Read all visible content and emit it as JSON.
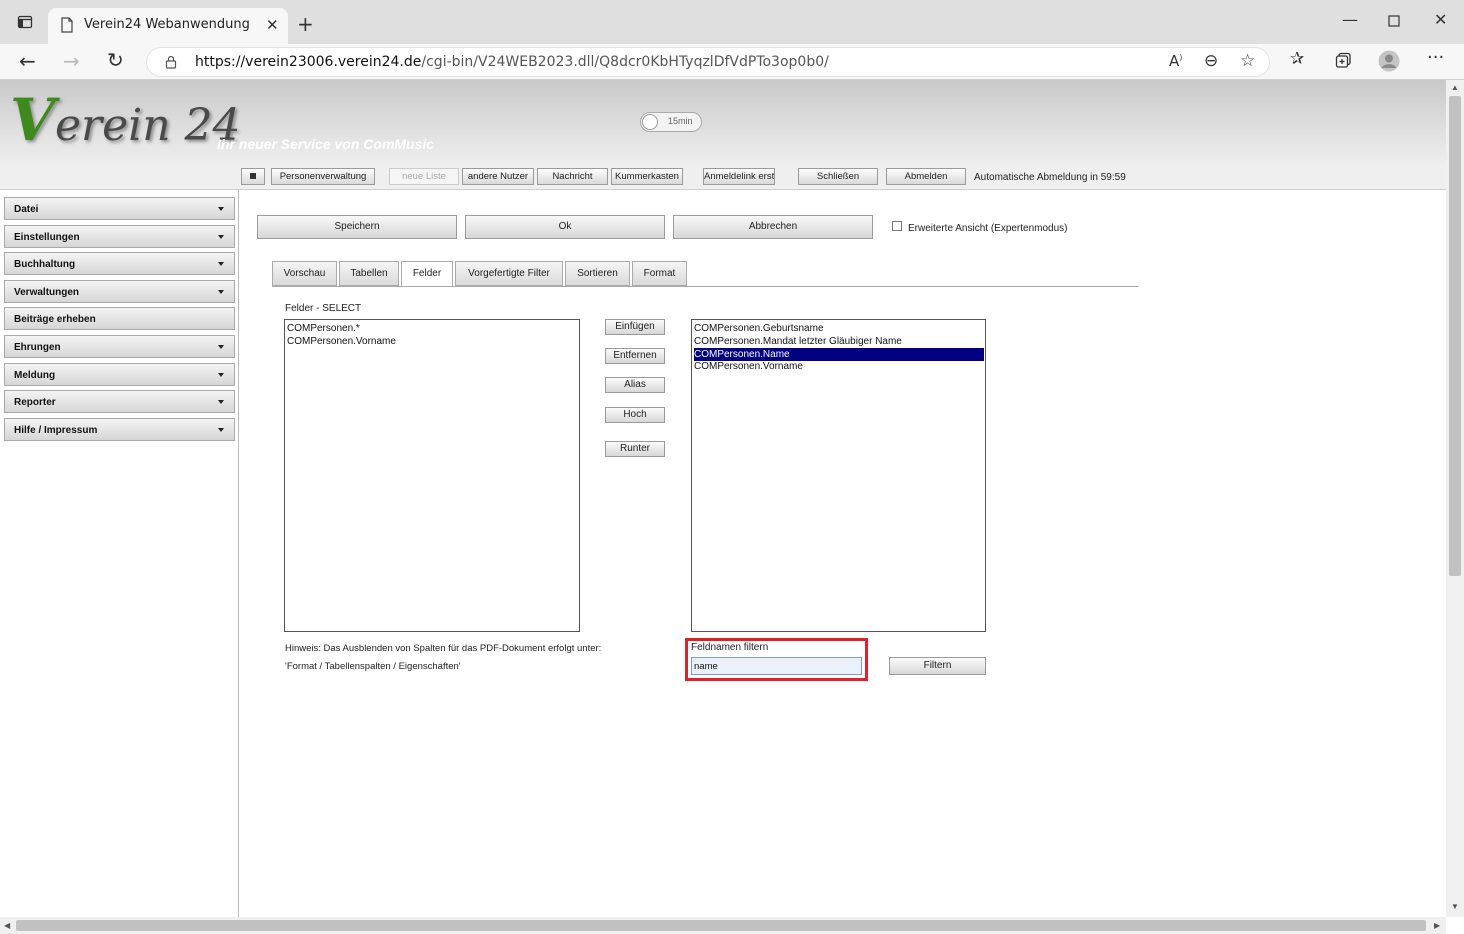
{
  "browser": {
    "tab_title": "Verein24 Webanwendung",
    "url_host": "https://verein23006.verein24.de",
    "url_path": "/cgi-bin/V24WEB2023.dll/Q8dcr0KbHTyqzlDfVdPTo3op0b0/",
    "icons": [
      "sidebar-toggle-icon",
      "page-icon",
      "close-icon",
      "plus-icon",
      "minimize-icon",
      "maximize-icon",
      "window-close-icon",
      "back-icon",
      "forward-icon",
      "reload-icon",
      "lock-icon",
      "read-aloud-icon",
      "zoom-out-icon",
      "add-favorite-icon",
      "favorites-icon",
      "collections-icon",
      "profile-icon",
      "more-icon"
    ]
  },
  "header": {
    "logo_v": "V",
    "logo_rest": "erein 24",
    "tagline": "Ihr neuer Service von ComMusic",
    "timer": "15min"
  },
  "toolbar": {
    "buttons": [
      "Personenverwaltung",
      "neue Liste",
      "andere Nutzer",
      "Nachricht",
      "Kummerkasten",
      "Anmeldelink erst",
      "Schließen",
      "Abmelden"
    ],
    "auto_logout": "Automatische Abmeldung in 59:59"
  },
  "sidebar": {
    "items": [
      "Datei",
      "Einstellungen",
      "Buchhaltung",
      "Verwaltungen",
      "Beiträge erheben",
      "Ehrungen",
      "Meldung",
      "Reporter",
      "Hilfe / Impressum"
    ]
  },
  "actions": {
    "save": "Speichern",
    "ok": "Ok",
    "cancel": "Abbrechen",
    "expert_mode": "Erweiterte Ansicht (Expertenmodus)"
  },
  "tabs": [
    "Vorschau",
    "Tabellen",
    "Felder",
    "Vorgefertigte Filter",
    "Sortieren",
    "Format"
  ],
  "active_tab": "Felder",
  "felder": {
    "label": "Felder - SELECT",
    "selected_fields": [
      "COMPersonen.*",
      "COMPersonen.Vorname"
    ],
    "buttons": [
      "Einfügen",
      "Entfernen",
      "Alias",
      "Hoch",
      "Runter"
    ],
    "available_fields": [
      "COMPersonen.Geburtsname",
      "COMPersonen.Mandat letzter Gläubiger Name",
      "COMPersonen.Name",
      "COMPersonen.Vorname"
    ],
    "selected_available": "COMPersonen.Name",
    "hint_line1": "Hinweis: Das Ausblenden von Spalten für das PDF-Dokument erfolgt unter:",
    "hint_line2": "'Format / Tabellenspalten / Eigenschaften'",
    "filter_label": "Feldnamen filtern",
    "filter_value": "name",
    "filter_button": "Filtern"
  }
}
